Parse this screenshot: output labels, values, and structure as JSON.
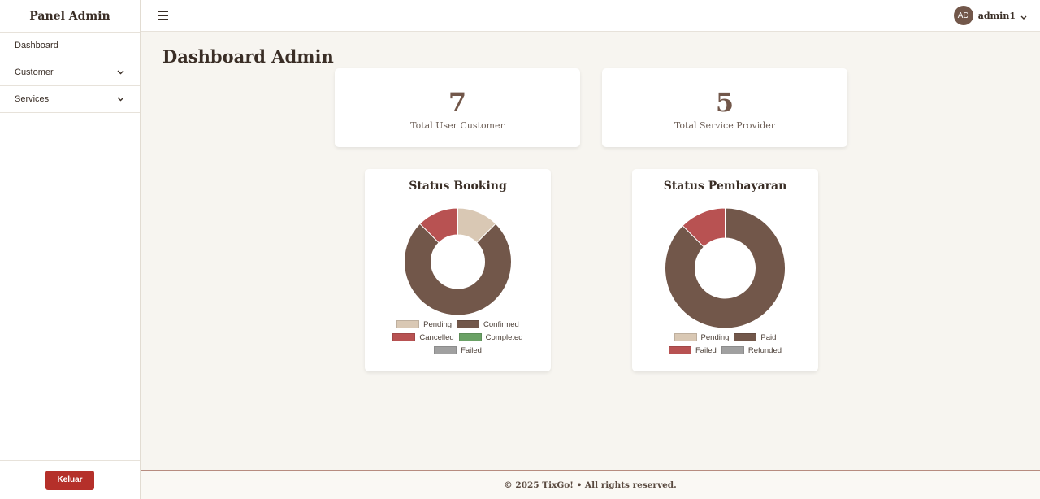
{
  "sidebar": {
    "brand": "Panel Admin",
    "items": [
      {
        "label": "Dashboard",
        "has_submenu": false
      },
      {
        "label": "Customer",
        "has_submenu": true
      },
      {
        "label": "Services",
        "has_submenu": true
      }
    ],
    "logout_label": "Keluar"
  },
  "topbar": {
    "menu_icon": "hamburger-icon",
    "avatar_initials": "AD",
    "username": "admin1"
  },
  "page": {
    "title": "Dashboard Admin"
  },
  "stats": [
    {
      "value": "7",
      "label": "Total User Customer"
    },
    {
      "value": "5",
      "label": "Total Service Provider"
    }
  ],
  "colors": {
    "pending": "#d9c8b4",
    "confirmed": "#72574a",
    "cancelled": "#b85252",
    "completed": "#6aa165",
    "failed": "#a0a0a0",
    "accent_red": "#b5302a"
  },
  "chart_data": [
    {
      "type": "pie",
      "title": "Status Booking",
      "categories": [
        "Pending",
        "Confirmed",
        "Cancelled",
        "Completed",
        "Failed"
      ],
      "values": [
        1,
        6,
        1,
        0,
        0
      ],
      "colors": [
        "#d9c8b4",
        "#72574a",
        "#b85252",
        "#6aa165",
        "#a0a0a0"
      ]
    },
    {
      "type": "pie",
      "title": "Status Pembayaran",
      "categories": [
        "Pending",
        "Paid",
        "Failed",
        "Refunded"
      ],
      "values": [
        0,
        7,
        1,
        0
      ],
      "colors": [
        "#d9c8b4",
        "#72574a",
        "#b85252",
        "#a0a0a0"
      ]
    }
  ],
  "footer": {
    "text": "© 2025 TixGo! • All rights reserved."
  }
}
